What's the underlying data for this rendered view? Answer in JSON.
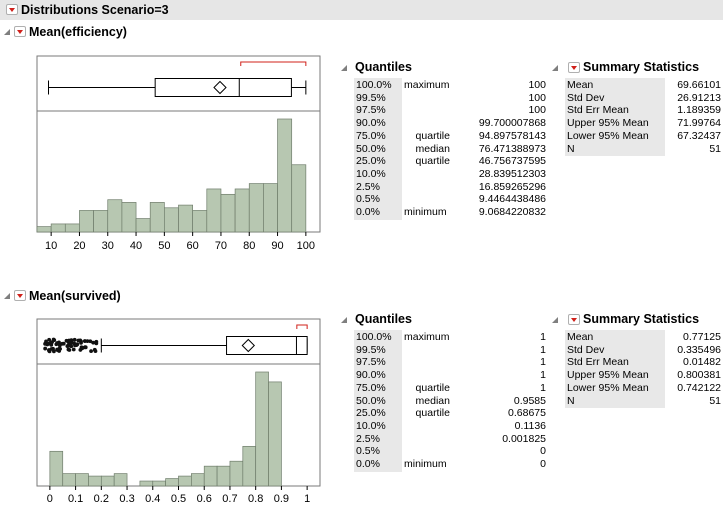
{
  "scenario_title": "Distributions Scenario=3",
  "sections": [
    {
      "title": "Mean(efficiency)",
      "axis_ticks": [
        "10",
        "20",
        "30",
        "40",
        "50",
        "60",
        "70",
        "80",
        "90",
        "100"
      ],
      "axis_range": [
        5,
        105
      ],
      "bins_start": 5,
      "bin_width": 5,
      "bin_heights": [
        2,
        3,
        3,
        8,
        8,
        12,
        11,
        5,
        11,
        9,
        10,
        8,
        16,
        14,
        16,
        18,
        18,
        42,
        25
      ],
      "box": {
        "min": 9.0684220832,
        "q1": 46.756737595,
        "median": 76.471388973,
        "q3": 94.897578143,
        "max": 100,
        "mean": 69.66101,
        "shortest_half": [
          77,
          100
        ]
      },
      "quantiles_title": "Quantiles",
      "quantiles": [
        {
          "pct": "100.0%",
          "label": "maximum",
          "value": "100"
        },
        {
          "pct": "99.5%",
          "label": "",
          "value": "100"
        },
        {
          "pct": "97.5%",
          "label": "",
          "value": "100"
        },
        {
          "pct": "90.0%",
          "label": "",
          "value": "99.700007868"
        },
        {
          "pct": "75.0%",
          "label": "quartile",
          "value": "94.897578143"
        },
        {
          "pct": "50.0%",
          "label": "median",
          "value": "76.471388973"
        },
        {
          "pct": "25.0%",
          "label": "quartile",
          "value": "46.756737595"
        },
        {
          "pct": "10.0%",
          "label": "",
          "value": "28.839512303"
        },
        {
          "pct": "2.5%",
          "label": "",
          "value": "16.859265296"
        },
        {
          "pct": "0.5%",
          "label": "",
          "value": "9.4464438486"
        },
        {
          "pct": "0.0%",
          "label": "minimum",
          "value": "9.0684220832"
        }
      ],
      "summary_title": "Summary Statistics",
      "summary": [
        {
          "label": "Mean",
          "value": "69.66101"
        },
        {
          "label": "Std Dev",
          "value": "26.91213"
        },
        {
          "label": "Std Err Mean",
          "value": "1.189359"
        },
        {
          "label": "Upper 95% Mean",
          "value": "71.99764"
        },
        {
          "label": "Lower 95% Mean",
          "value": "67.32437"
        },
        {
          "label": "N",
          "value": "51"
        }
      ]
    },
    {
      "title": "Mean(survived)",
      "axis_ticks": [
        "0",
        "0.1",
        "0.2",
        "0.3",
        "0.4",
        "0.5",
        "0.6",
        "0.7",
        "0.8",
        "0.9",
        "1"
      ],
      "axis_range": [
        -0.05,
        1.05
      ],
      "bins_start": -0.05,
      "bin_width": 0.05,
      "bin_heights": [
        0,
        14,
        5,
        5,
        4,
        4,
        5,
        0,
        2,
        2,
        3,
        4,
        5,
        8,
        8,
        10,
        16,
        46,
        42
      ],
      "box": {
        "min": 0.2,
        "q1": 0.68675,
        "median": 0.9585,
        "q3": 1,
        "max": 1,
        "mean": 0.77125,
        "shortest_half": [
          0.96,
          1
        ]
      },
      "quantiles_title": "Quantiles",
      "quantiles": [
        {
          "pct": "100.0%",
          "label": "maximum",
          "value": "1"
        },
        {
          "pct": "99.5%",
          "label": "",
          "value": "1"
        },
        {
          "pct": "97.5%",
          "label": "",
          "value": "1"
        },
        {
          "pct": "90.0%",
          "label": "",
          "value": "1"
        },
        {
          "pct": "75.0%",
          "label": "quartile",
          "value": "1"
        },
        {
          "pct": "50.0%",
          "label": "median",
          "value": "0.9585"
        },
        {
          "pct": "25.0%",
          "label": "quartile",
          "value": "0.68675"
        },
        {
          "pct": "10.0%",
          "label": "",
          "value": "0.1136"
        },
        {
          "pct": "2.5%",
          "label": "",
          "value": "0.001825"
        },
        {
          "pct": "0.5%",
          "label": "",
          "value": "0"
        },
        {
          "pct": "0.0%",
          "label": "minimum",
          "value": "0"
        }
      ],
      "summary_title": "Summary Statistics",
      "summary": [
        {
          "label": "Mean",
          "value": "0.77125"
        },
        {
          "label": "Std Dev",
          "value": "0.335496"
        },
        {
          "label": "Std Err Mean",
          "value": "0.01482"
        },
        {
          "label": "Upper 95% Mean",
          "value": "0.800381"
        },
        {
          "label": "Lower 95% Mean",
          "value": "0.742122"
        },
        {
          "label": "N",
          "value": "51"
        }
      ]
    }
  ],
  "colors": {
    "bar_fill": "#b7c7b1",
    "bar_stroke": "#6f7d6b",
    "red_bracket": "#d0201a",
    "header_bg": "#e6e6e6"
  }
}
